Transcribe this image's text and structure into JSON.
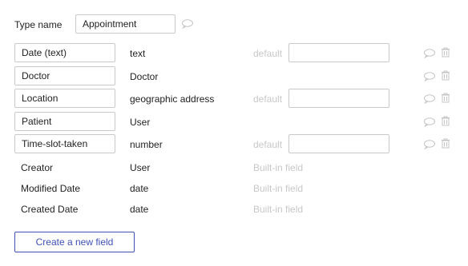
{
  "type_name": {
    "label": "Type name",
    "value": "Appointment"
  },
  "fields": [
    {
      "name": "Date (text)",
      "type": "text",
      "has_default": true,
      "default_label": "default",
      "default_value": ""
    },
    {
      "name": "Doctor",
      "type": "Doctor",
      "has_default": false
    },
    {
      "name": "Location",
      "type": "geographic address",
      "has_default": true,
      "default_label": "default",
      "default_value": ""
    },
    {
      "name": "Patient",
      "type": "User",
      "has_default": false
    },
    {
      "name": "Time-slot-taken",
      "type": "number",
      "has_default": true,
      "default_label": "default",
      "default_value": ""
    }
  ],
  "builtin_fields": [
    {
      "name": "Creator",
      "type": "User",
      "note": "Built-in field"
    },
    {
      "name": "Modified Date",
      "type": "date",
      "note": "Built-in field"
    },
    {
      "name": "Created Date",
      "type": "date",
      "note": "Built-in field"
    }
  ],
  "create_button": "Create a new field",
  "icons": {
    "comment": "comment-icon",
    "delete": "trash-icon"
  }
}
